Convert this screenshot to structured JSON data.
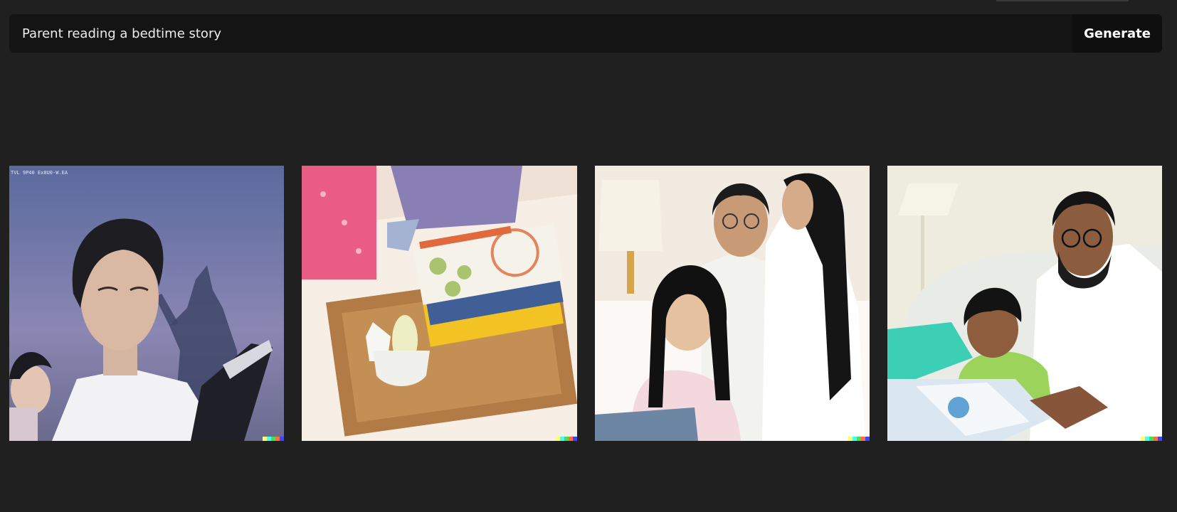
{
  "prompt": {
    "value": "Parent reading a bedtime story",
    "placeholder": ""
  },
  "generate_label": "Generate",
  "gallery": {
    "images": [
      {
        "subject": "man reading with child in twilight"
      },
      {
        "subject": "wooden tray with book and cup on bed"
      },
      {
        "subject": "family reading a book together"
      },
      {
        "subject": "father reading to son in bed"
      }
    ]
  },
  "colors": {
    "background": "#202020",
    "bar": "#141414",
    "text": "#ececec",
    "signature": [
      "#ffff66",
      "#42ffff",
      "#51da4c",
      "#ff6e3c",
      "#3c46ff"
    ]
  }
}
